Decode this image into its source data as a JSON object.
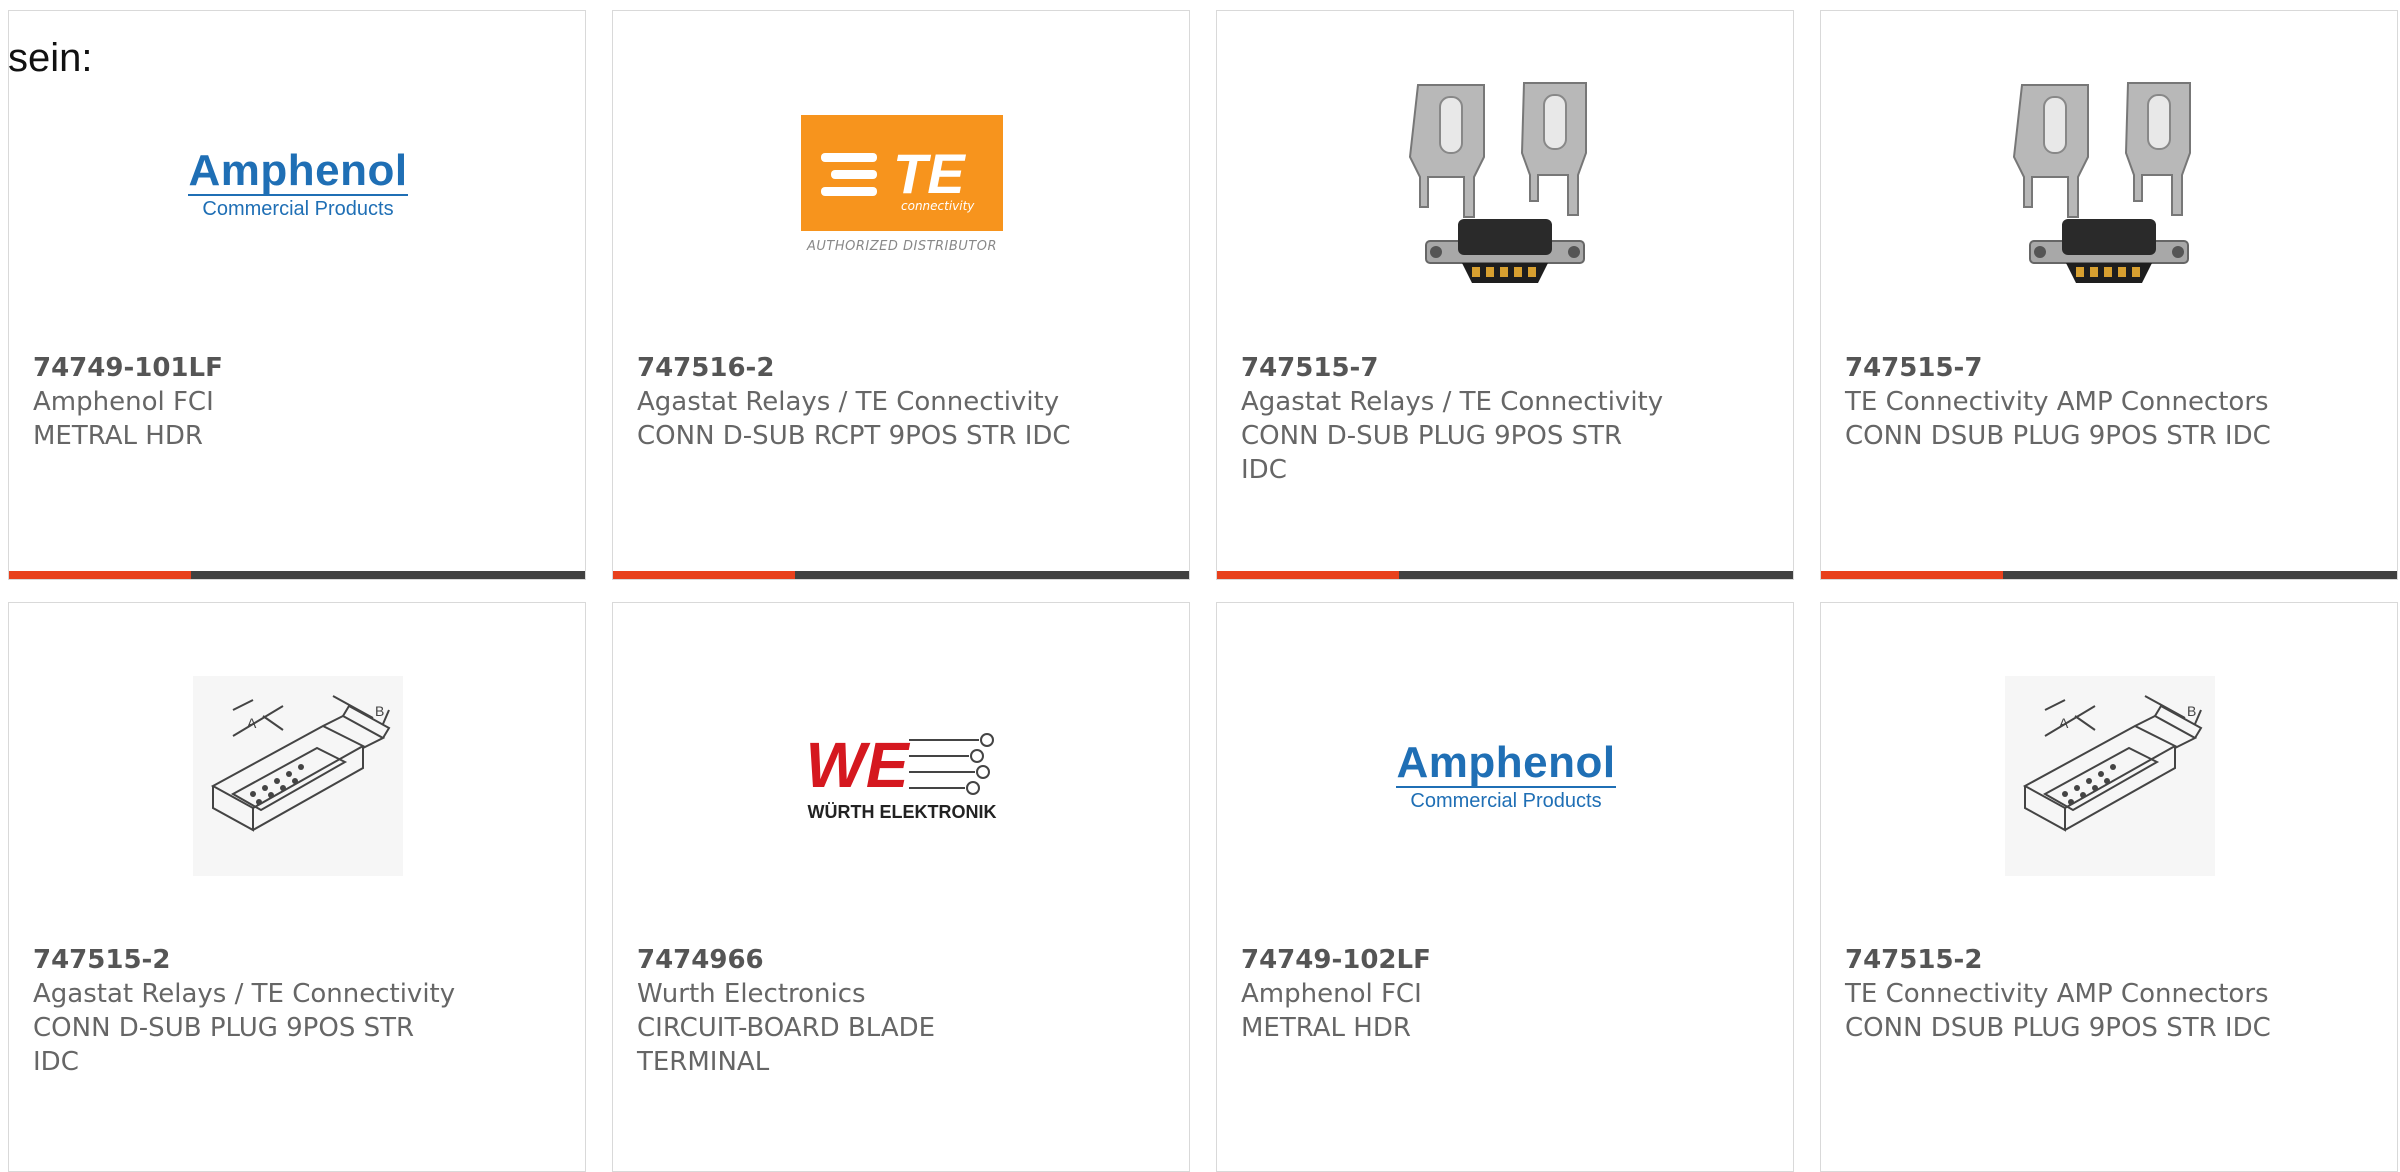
{
  "intro_text": "sein:",
  "colors": {
    "accent": "#e8401c",
    "bar": "#404040",
    "amphenol_blue": "#1f6fb5",
    "te_orange": "#f7941d",
    "wurth_red": "#d5181f"
  },
  "products": [
    {
      "part_number": "74749-101LF",
      "manufacturer": "Amphenol FCI",
      "description": "METRAL HDR",
      "image": "amphenol-logo"
    },
    {
      "part_number": "747516-2",
      "manufacturer": "Agastat Relays / TE Connectivity",
      "description": "CONN D-SUB RCPT 9POS STR IDC",
      "image": "te-logo"
    },
    {
      "part_number": "747515-7",
      "manufacturer": "Agastat Relays / TE Connectivity",
      "description": "CONN D-SUB PLUG 9POS STR IDC",
      "image": "dsub-connector-photo"
    },
    {
      "part_number": "747515-7",
      "manufacturer": "TE Connectivity AMP Connectors",
      "description": "CONN DSUB PLUG 9POS STR IDC",
      "image": "dsub-connector-photo"
    },
    {
      "part_number": "747515-2",
      "manufacturer": "Agastat Relays / TE Connectivity",
      "description": "CONN D-SUB PLUG 9POS STR IDC",
      "image": "dsub-drawing"
    },
    {
      "part_number": "7474966",
      "manufacturer": "Wurth Electronics",
      "description": "CIRCUIT-BOARD BLADE TERMINAL",
      "image": "wurth-logo"
    },
    {
      "part_number": "74749-102LF",
      "manufacturer": "Amphenol FCI",
      "description": "METRAL HDR",
      "image": "amphenol-logo"
    },
    {
      "part_number": "747515-2",
      "manufacturer": "TE Connectivity AMP Connectors",
      "description": "CONN DSUB PLUG 9POS STR IDC",
      "image": "dsub-drawing"
    }
  ],
  "logos": {
    "amphenol": {
      "name": "Amphenol",
      "subtitle": "Commercial Products"
    },
    "te": {
      "name": "TE",
      "subtitle": "connectivity",
      "badge": "AUTHORIZED DISTRIBUTOR"
    },
    "wurth": {
      "name": "WE",
      "subtitle": "WÜRTH ELEKTRONIK"
    }
  }
}
